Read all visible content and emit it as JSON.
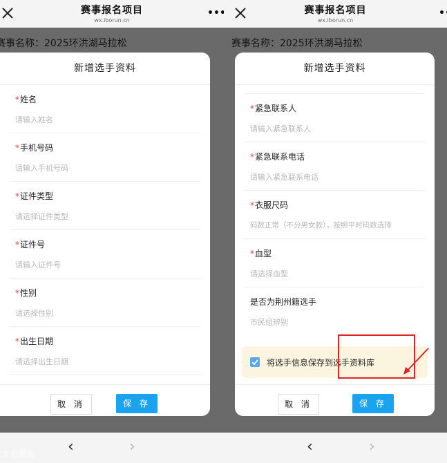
{
  "header": {
    "title": "赛事报名项目",
    "subtitle": "wx.iborun.cn",
    "close_icon": "close-icon",
    "more_icon": "more-icon",
    "more_glyph": "•••"
  },
  "event_name": "赛事名称：2025环洪湖马拉松",
  "modal": {
    "title": "新增选手资料",
    "required_mark": "*",
    "left_fields": [
      {
        "label": "姓名",
        "placeholder": "请输入姓名"
      },
      {
        "label": "手机号码",
        "placeholder": "请输入手机号码"
      },
      {
        "label": "证件类型",
        "placeholder": "请选择证件类型"
      },
      {
        "label": "证件号",
        "placeholder": "请输入证件号"
      },
      {
        "label": "性别",
        "placeholder": "请选择性别"
      },
      {
        "label": "出生日期",
        "placeholder": "请选择出生日期"
      }
    ],
    "right_fields": [
      {
        "label": "紧急联系人",
        "placeholder": "请输入紧急联系人",
        "required": true
      },
      {
        "label": "紧急联系电话",
        "placeholder": "请输入紧急联系电话",
        "required": true
      },
      {
        "label": "衣服尺码",
        "placeholder": "码数正常（不分男女款），按照平时码数选择",
        "required": true
      },
      {
        "label": "血型",
        "placeholder": "请选择血型",
        "required": true
      },
      {
        "label": "是否为荆州籍选手",
        "placeholder": "市民组辨别",
        "required": false
      }
    ],
    "save_to_library": {
      "label": "将选手信息保存到选手资料库",
      "checked": true
    },
    "cancel_label": "取 消",
    "save_label": "保 存"
  },
  "nav": {
    "back_glyph": "‹",
    "forward_glyph": "›"
  },
  "watermark": "大毛说说",
  "colors": {
    "accent": "#1aa3f0",
    "required": "#e64340",
    "highlight": "#e02424"
  }
}
